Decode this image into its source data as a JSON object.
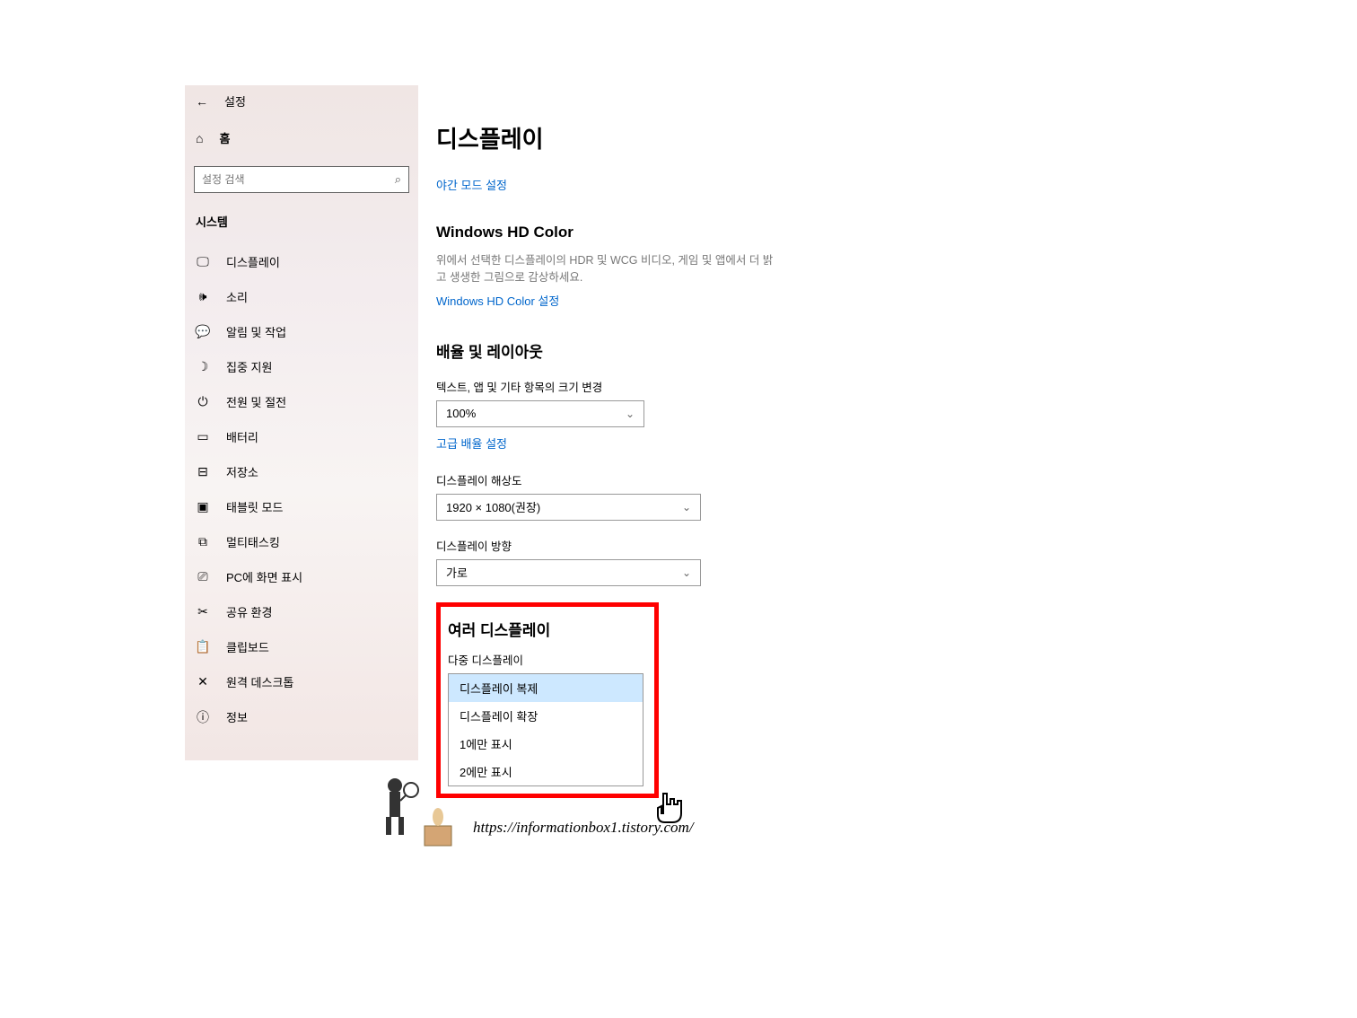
{
  "sidebar": {
    "title": "설정",
    "home_label": "홈",
    "search_placeholder": "설정 검색",
    "section_label": "시스템",
    "items": [
      {
        "icon": "display",
        "label": "디스플레이"
      },
      {
        "icon": "sound",
        "label": "소리"
      },
      {
        "icon": "notify",
        "label": "알림 및 작업"
      },
      {
        "icon": "focus",
        "label": "집중 지원"
      },
      {
        "icon": "power",
        "label": "전원 및 절전"
      },
      {
        "icon": "battery",
        "label": "배터리"
      },
      {
        "icon": "storage",
        "label": "저장소"
      },
      {
        "icon": "tablet",
        "label": "태블릿 모드"
      },
      {
        "icon": "multitask",
        "label": "멀티태스킹"
      },
      {
        "icon": "project",
        "label": "PC에 화면 표시"
      },
      {
        "icon": "share",
        "label": "공유 환경"
      },
      {
        "icon": "clipboard",
        "label": "클립보드"
      },
      {
        "icon": "remote",
        "label": "원격 데스크톱"
      },
      {
        "icon": "info",
        "label": "정보"
      }
    ]
  },
  "main": {
    "page_title": "디스플레이",
    "night_mode_link": "야간 모드 설정",
    "hdcolor": {
      "title": "Windows HD Color",
      "desc": "위에서 선택한 디스플레이의 HDR 및 WCG 비디오, 게임 및 앱에서 더 밝고 생생한 그림으로 감상하세요.",
      "link": "Windows HD Color 설정"
    },
    "scale_layout": {
      "title": "배율 및 레이아웃",
      "text_scale_label": "텍스트, 앱 및 기타 항목의 크기 변경",
      "text_scale_value": "100%",
      "advanced_link": "고급 배율 설정",
      "resolution_label": "디스플레이 해상도",
      "resolution_value": "1920 × 1080(권장)",
      "orientation_label": "디스플레이 방향",
      "orientation_value": "가로"
    },
    "multi_display": {
      "title": "여러 디스플레이",
      "label": "다중 디스플레이",
      "options": [
        "디스플레이 복제",
        "디스플레이 확장",
        "1에만 표시",
        "2에만 표시"
      ]
    }
  },
  "footer_url": "https://informationbox1.tistory.com/"
}
